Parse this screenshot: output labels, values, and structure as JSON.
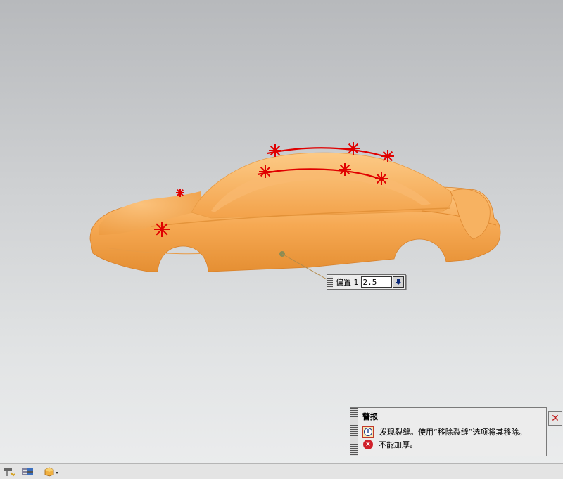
{
  "offset": {
    "label": "偏置 1",
    "value": "2.5"
  },
  "alert": {
    "title": "警报",
    "messages": [
      {
        "type": "info",
        "text": "发现裂缝。使用“移除裂缝”选项将其移除。"
      },
      {
        "type": "error",
        "text": "不能加厚。"
      }
    ]
  },
  "icons": {
    "info": "info-icon",
    "error": "error-icon",
    "close": "close-icon",
    "dropdown": "down-arrow-icon"
  },
  "colors": {
    "car_body": "#f7a84e",
    "marker": "#e00000",
    "viewport_top": "#b7b9bc",
    "viewport_bottom": "#ecedee"
  }
}
